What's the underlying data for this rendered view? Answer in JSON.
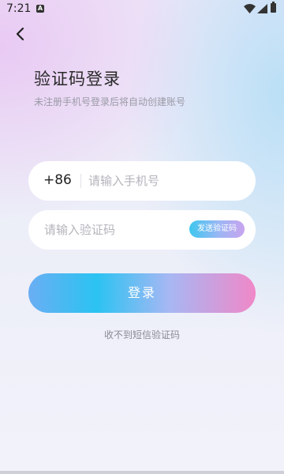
{
  "status_bar": {
    "time": "7:21",
    "icons": [
      "a-notification-icon",
      "wifi-icon",
      "signal-icon",
      "battery-icon"
    ]
  },
  "nav": {
    "back_icon": "chevron-left-icon"
  },
  "header": {
    "title": "验证码登录",
    "subtitle": "未注册手机号登录后将自动创建账号"
  },
  "phone_field": {
    "country_code": "+86",
    "placeholder": "请输入手机号",
    "value": ""
  },
  "code_field": {
    "placeholder": "请输入验证码",
    "value": "",
    "send_code_label": "发送验证码"
  },
  "login_button": {
    "label": "登录"
  },
  "footer": {
    "no_sms_link": "收不到短信验证码"
  },
  "colors": {
    "login_gradient": [
      "#6aaef3",
      "#2bc3f2",
      "#a7b7f3",
      "#f088c8"
    ],
    "send_code_gradient": [
      "#3ec7ef",
      "#9db6f4",
      "#c8a4ee"
    ],
    "title_text": "#2a2a2a",
    "subtitle_text": "#9a9aa6"
  }
}
